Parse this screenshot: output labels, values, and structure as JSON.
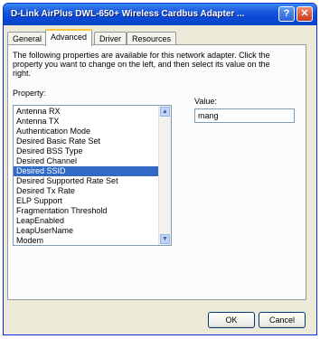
{
  "window": {
    "title": "D-Link AirPlus DWL-650+ Wireless Cardbus Adapter ...",
    "help_glyph": "?",
    "close_glyph": "✕"
  },
  "tabs": [
    {
      "label": "General",
      "active": false
    },
    {
      "label": "Advanced",
      "active": true
    },
    {
      "label": "Driver",
      "active": false
    },
    {
      "label": "Resources",
      "active": false
    }
  ],
  "advanced": {
    "description": "The following properties are available for this network adapter. Click the property you want to change on the left, and then select its value on the right.",
    "property_label": "Property:",
    "value_label": "Value:",
    "value": "mang",
    "properties": [
      "Antenna RX",
      "Antenna TX",
      "Authentication Mode",
      "Desired Basic Rate Set",
      "Desired BSS Type",
      "Desired Channel",
      "Desired SSID",
      "Desired Supported Rate Set",
      "Desired Tx Rate",
      "ELP Support",
      "Fragmentation Threshold",
      "LeapEnabled",
      "LeapUserName",
      "Modem"
    ],
    "selected_property": "Desired SSID"
  },
  "buttons": {
    "ok": "OK",
    "cancel": "Cancel"
  },
  "icons": {
    "scroll_up": "▲",
    "scroll_down": "▼"
  }
}
